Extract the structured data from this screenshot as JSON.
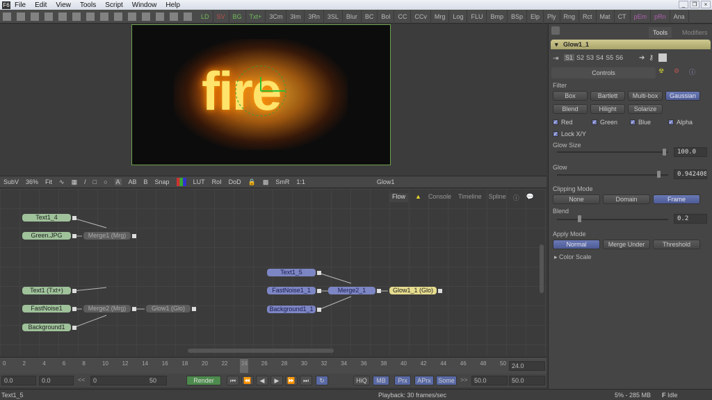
{
  "menubar": {
    "logo": "F6",
    "items": [
      "File",
      "Edit",
      "View",
      "Tools",
      "Script",
      "Window",
      "Help"
    ]
  },
  "toolbar": {
    "tools": [
      "LD",
      "SV",
      "BG",
      "Txt+",
      "3Cm",
      "3Im",
      "3Rn",
      "3SL",
      "Blur",
      "BC",
      "Bol",
      "CC",
      "CCv",
      "Mrg",
      "Log",
      "FLU",
      "Bmp",
      "BSp",
      "Elp",
      "Ply",
      "Rng",
      "Rct",
      "Mat",
      "CT",
      "pEm",
      "pRn",
      "Ana"
    ],
    "tool_colors": {
      "LD": "#6fbf5a",
      "SV": "#c05050",
      "BG": "#6fbf5a",
      "Txt+": "#6fbf5a",
      "pEm": "#b060b0",
      "pRn": "#b060b0"
    }
  },
  "viewer": {
    "image_text": "fire",
    "toolbar": {
      "subv": "SubV",
      "zoom": "36%",
      "fit": "Fit",
      "snap": "Snap",
      "lut": "LUT",
      "roi": "RoI",
      "dod": "DoD",
      "smr": "SmR",
      "one_to_one": "1:1",
      "viewing": "Glow1"
    }
  },
  "flow": {
    "tabs": [
      "Flow",
      "Console",
      "Timeline",
      "Spline"
    ],
    "active_tab": "Flow",
    "nodes": [
      {
        "label": "Text1_4",
        "color": "green"
      },
      {
        "label": "Green.JPG",
        "color": "green"
      },
      {
        "label": "Merge1 (Mrg)",
        "color": "gray"
      },
      {
        "label": "Text1 (Txt+)",
        "color": "green"
      },
      {
        "label": "FastNoise1",
        "color": "green"
      },
      {
        "label": "Merge2 (Mrg)",
        "color": "gray"
      },
      {
        "label": "Glow1 (Glo)",
        "color": "gray"
      },
      {
        "label": "Background1",
        "color": "green"
      },
      {
        "label": "Text1_5",
        "color": "blue"
      },
      {
        "label": "FastNoise1_1",
        "color": "blue"
      },
      {
        "label": "Merge2_1",
        "color": "blue"
      },
      {
        "label": "Glow1_1 (Glo)",
        "color": "yellow"
      },
      {
        "label": "Background1_1",
        "color": "blue"
      }
    ]
  },
  "timeline": {
    "ticks": [
      "0",
      "2",
      "4",
      "6",
      "8",
      "10",
      "12",
      "14",
      "16",
      "18",
      "20",
      "22",
      "24",
      "26",
      "28",
      "30",
      "32",
      "34",
      "36",
      "38",
      "40",
      "42",
      "44",
      "46",
      "48",
      "50"
    ],
    "current_frame": "24",
    "current_time": "24.0"
  },
  "transport": {
    "global_start": "0.0",
    "render_start": "0.0",
    "range_start": "0",
    "range_end": "50",
    "render_label": "Render",
    "hiq": "HiQ",
    "mb": "MB",
    "prx": "Prx",
    "aprx": "APrx",
    "some": "Some",
    "render_end": "50.0",
    "global_end": "50.0"
  },
  "status": {
    "selected": "Text1_5",
    "playback": "Playback: 30 frames/sec",
    "memory": "5% - 285 MB",
    "state": "Idle"
  },
  "panel": {
    "tabs": [
      "Tools",
      "Modifiers"
    ],
    "active_tab": "Tools",
    "tool_name": "Glow1_1",
    "slots": [
      "S1",
      "S2",
      "S3",
      "S4",
      "S5",
      "S6"
    ],
    "controls_tab": "Controls",
    "filter_label": "Filter",
    "filters": [
      "Box",
      "Bartlett",
      "Multi-box",
      "Gaussian",
      "Blend",
      "Hilight",
      "Solarize"
    ],
    "filter_selected": "Gaussian",
    "channels": [
      {
        "label": "Red",
        "checked": true
      },
      {
        "label": "Green",
        "checked": true
      },
      {
        "label": "Blue",
        "checked": true
      },
      {
        "label": "Alpha",
        "checked": true
      }
    ],
    "lock_xy": {
      "label": "Lock X/Y",
      "checked": true
    },
    "glow_size": {
      "label": "Glow Size",
      "value": "100.0"
    },
    "glow": {
      "label": "Glow",
      "value": "0.942408"
    },
    "clipping": {
      "label": "Clipping Mode",
      "options": [
        "None",
        "Domain",
        "Frame"
      ],
      "selected": "Frame"
    },
    "blend": {
      "label": "Blend",
      "value": "0.2"
    },
    "apply": {
      "label": "Apply Mode",
      "options": [
        "Normal",
        "Merge Under",
        "Threshold"
      ],
      "selected": "Normal"
    },
    "color_scale": "Color Scale"
  }
}
